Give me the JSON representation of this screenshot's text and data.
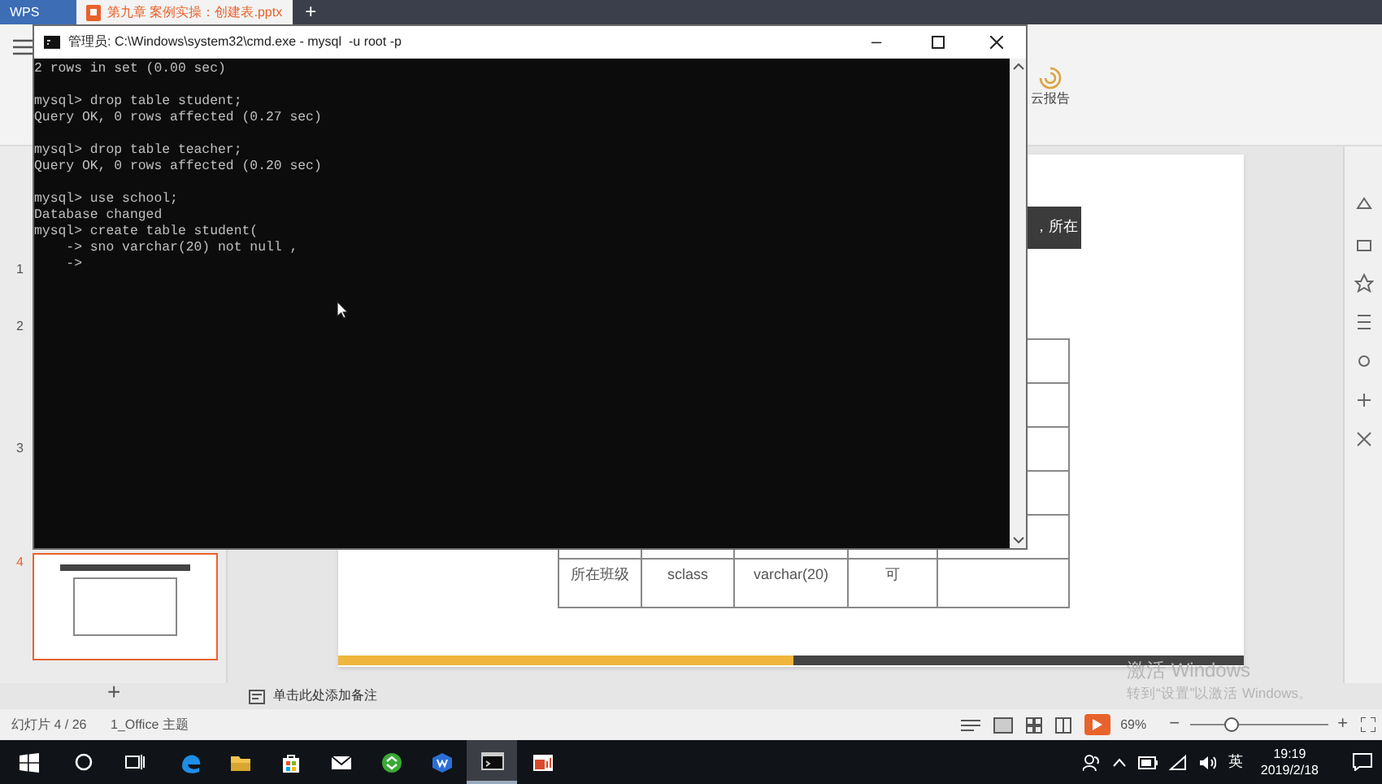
{
  "wps_tabs": [
    {
      "label": "WPS",
      "selected": false
    },
    {
      "label": "第九章 案例实操：创建表.pptx",
      "selected": true
    }
  ],
  "new_tab": "+",
  "add_slide": "+",
  "zoom_out": "−",
  "zoom_in": "+",
  "minimize": "–",
  "ribbon": {
    "cloud_report": "云报告"
  },
  "slide_panel": {
    "slides": [
      {
        "number": "1",
        "selected": false
      },
      {
        "number": "2",
        "selected": false
      },
      {
        "number": "3",
        "selected": false
      },
      {
        "number": "4",
        "selected": true
      }
    ]
  },
  "slide": {
    "title_fragment": "，所在",
    "visible_row": [
      "所在班级",
      "sclass",
      "varchar(20)",
      "可"
    ]
  },
  "notes": {
    "placeholder": "单击此处添加备注"
  },
  "status_bar": {
    "slide_counter": "幻灯片 4 / 26",
    "theme": "1_Office 主题",
    "zoom": "69%",
    "zoom_slider": {
      "level": 0.3
    }
  },
  "cmd_window": {
    "title": "管理员: C:\\Windows\\system32\\cmd.exe - mysql  -u root -p",
    "blocks": [
      [
        "2 rows in set (0.00 sec)"
      ],
      [
        "mysql> drop table student;",
        "Query OK, 0 rows affected (0.27 sec)"
      ],
      [
        "mysql> drop table teacher;",
        "Query OK, 0 rows affected (0.20 sec)"
      ],
      [
        "mysql> use school;",
        "Database changed",
        "mysql> create table student(",
        "    -> sno varchar(20) not null ,",
        "    ->"
      ]
    ]
  },
  "activation": {
    "heading": "激活 Windows",
    "hint": "转到“设置”以激活 Windows。"
  },
  "taskbar": {
    "apps": [
      {
        "kind": "edge",
        "active": false
      },
      {
        "kind": "folder",
        "active": false
      },
      {
        "kind": "store",
        "active": false
      },
      {
        "kind": "mail",
        "active": false
      },
      {
        "kind": "green",
        "active": false
      },
      {
        "kind": "writer",
        "active": false
      },
      {
        "kind": "console",
        "active": true
      },
      {
        "kind": "slides",
        "active": false
      }
    ],
    "ime": "英",
    "time": "19:19",
    "date": "2019/2/18"
  }
}
